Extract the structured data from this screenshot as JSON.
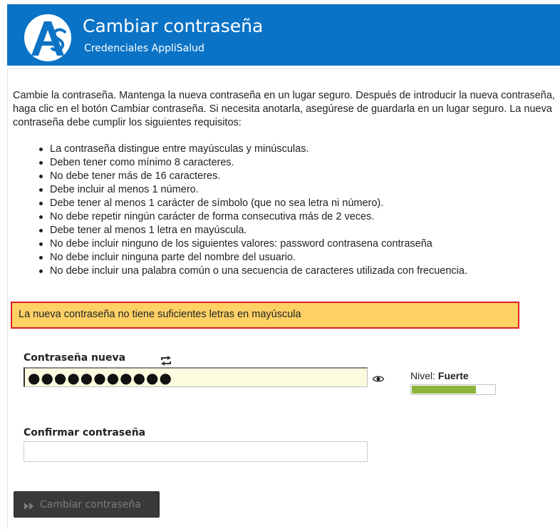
{
  "header": {
    "title": "Cambiar contraseña",
    "subtitle": "Credenciales AppliSalud",
    "logo_icon": "applisalud-logo-icon",
    "background_color": "#0a73c6"
  },
  "instructions": {
    "intro": "Cambie la contraseña. Mantenga la nueva contraseña en un lugar seguro. Después de introducir la nueva contraseña, haga clic en el botón Cambiar contraseña. Si necesita anotarla, asegúrese de guardarla en un lugar seguro. La nueva contraseña debe cumplir los siguientes requisitos:",
    "requirements": [
      "La contraseña distingue entre mayúsculas y minúsculas.",
      "Deben tener como mínimo 8 caracteres.",
      "No debe tener más de 16 caracteres.",
      "Debe incluir al menos 1 número.",
      "Debe tener al menos 1 carácter de símbolo (que no sea letra ni número).",
      "No debe repetir ningún carácter de forma consecutiva más de 2 veces.",
      "Debe tener al menos 1 letra en mayúscula.",
      "No debe incluir ninguno de los siguientes valores: password contrasena contraseña",
      "No debe incluir ninguna parte del nombre del usuario.",
      "No debe incluir una palabra común o una secuencia de caracteres utilizada con frecuencia."
    ]
  },
  "alert": {
    "message": "La nueva contraseña no tiene suficientes letras en mayúscula",
    "background_color": "#ffd165",
    "border_color": "#dc1f26"
  },
  "new_password": {
    "label": "Contraseña nueva",
    "masked_value": "●●●●●●●●●●●",
    "generate_icon": "refresh-icon",
    "show_icon": "eye-icon",
    "strength_label": "Nivel:",
    "strength_value": "Fuerte",
    "strength_fraction": 0.78,
    "strength_color": "#8cb43a"
  },
  "confirm_password": {
    "label": "Confirmar contraseña",
    "value": ""
  },
  "submit": {
    "label": "Cambiar contraseña",
    "icon": "double-chevron-right-icon"
  }
}
